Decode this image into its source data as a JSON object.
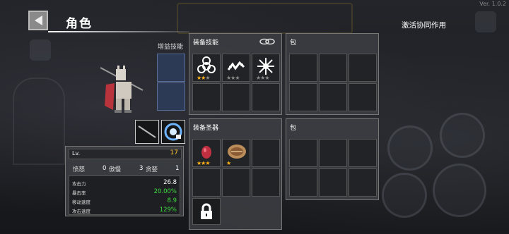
{
  "version": "Ver. 1.0.2",
  "header": {
    "title": "角色",
    "activate_label": "激活协同作用"
  },
  "augment": {
    "label": "增益技能"
  },
  "skills_panel": {
    "title": "装备技能",
    "items": [
      {
        "icon": "biohazard-skill-icon",
        "stars": [
          1,
          1,
          0
        ]
      },
      {
        "icon": "chain-skill-icon",
        "stars": [
          0,
          0,
          0
        ]
      },
      {
        "icon": "burst-skill-icon",
        "stars": [
          0,
          0,
          0
        ]
      }
    ]
  },
  "relics_panel": {
    "title": "装备圣器",
    "items": [
      {
        "icon": "red-egg-relic-icon",
        "stars": [
          1,
          1,
          1
        ]
      },
      {
        "icon": "shield-scroll-relic-icon",
        "stars": [
          1,
          0,
          0
        ]
      }
    ]
  },
  "bag_top": {
    "title": "包"
  },
  "bag_bottom": {
    "title": "包"
  },
  "stats": {
    "level_label": "Lv.",
    "level_value": "17",
    "traits": [
      {
        "name": "愤怒",
        "value": "0"
      },
      {
        "name": "傲慢",
        "value": "3"
      },
      {
        "name": "贪婪",
        "value": "1"
      }
    ],
    "rows": [
      {
        "label": "攻击力",
        "value": "26.8",
        "color": "#ffffff"
      },
      {
        "label": "暴击率",
        "value": "20.00%",
        "color": "#3fdc3f"
      },
      {
        "label": "移动速度",
        "value": "8.9",
        "color": "#3fdc3f"
      },
      {
        "label": "攻击速度",
        "value": "129%",
        "color": "#3fdc3f"
      }
    ]
  },
  "colors": {
    "accent_star": "#ffb21a",
    "level": "#ffcc33",
    "bonus_green": "#3fdc3f"
  }
}
